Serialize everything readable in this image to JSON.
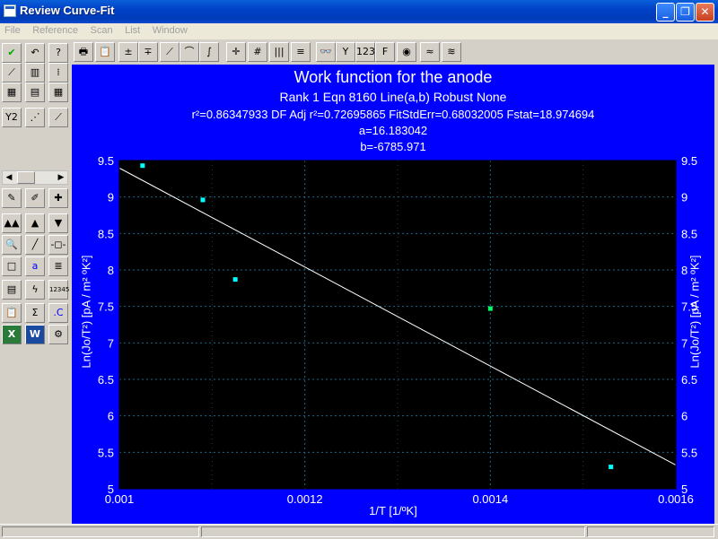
{
  "window": {
    "title": "Review Curve-Fit",
    "controls": [
      "_",
      "❐",
      "✕"
    ]
  },
  "menu": [
    "File",
    "Reference",
    "Scan",
    "List",
    "Window"
  ],
  "toolbar": [
    {
      "name": "print-icon",
      "glyph": "🖶"
    },
    {
      "name": "clipboard-icon",
      "glyph": "📋"
    },
    {
      "name": "plus-box-icon",
      "glyph": "±"
    },
    {
      "name": "minus-box-icon",
      "glyph": "∓"
    },
    {
      "name": "curve-linear-icon",
      "glyph": "⟋"
    },
    {
      "name": "curve-smooth-icon",
      "glyph": "⌒"
    },
    {
      "name": "curve-rise-icon",
      "glyph": "∫"
    },
    {
      "name": "crosshair-icon",
      "glyph": "✛"
    },
    {
      "name": "grid-icon",
      "glyph": "#"
    },
    {
      "name": "bars-icon",
      "glyph": "|||"
    },
    {
      "name": "list-icon",
      "glyph": "≡"
    },
    {
      "name": "binoculars-icon",
      "glyph": "👓"
    },
    {
      "name": "tree-icon",
      "glyph": "Y"
    },
    {
      "name": "numeric-icon",
      "glyph": "123"
    },
    {
      "name": "font-icon",
      "glyph": "F"
    },
    {
      "name": "color-wheel-icon",
      "glyph": "◉"
    },
    {
      "name": "multi-curve-icon",
      "glyph": "≈"
    },
    {
      "name": "multi-curve-alt-icon",
      "glyph": "≋"
    }
  ],
  "palette": [
    [
      "check-icon",
      "undo-icon",
      "help-icon"
    ],
    [
      "fit-line-icon",
      "fit-bars-icon",
      "fit-dots-icon"
    ],
    [
      "fit-grid-icon",
      "fit-stack-icon",
      "fit-table-icon"
    ],
    [
      "y2-icon",
      "fit-scatter-icon",
      "fit-trend-icon"
    ],
    [
      "pen-icon",
      "pen-alt-icon",
      "pen-plus-icon"
    ],
    [
      "triangles-icon",
      "triangle-up-icon",
      "triangle-down-icon"
    ],
    [
      "zoom-icon",
      "diagonal-icon",
      "point-icon"
    ],
    [
      "blank-icon",
      "a-letter-icon",
      "hatch-icon"
    ],
    [
      "sheet-icon",
      "lightning-icon",
      "numbers-icon"
    ],
    [
      "paste-icon",
      "sigma-icon",
      "c-letter-icon"
    ],
    [
      "excel-icon",
      "word-icon",
      "gear-icon"
    ]
  ],
  "palette_glyphs": {
    "check-icon": "✔",
    "undo-icon": "↶",
    "help-icon": "?",
    "fit-line-icon": "⟋",
    "fit-bars-icon": "▥",
    "fit-dots-icon": "⁞",
    "fit-grid-icon": "▦",
    "fit-stack-icon": "▤",
    "fit-table-icon": "▦",
    "y2-icon": "Y2",
    "fit-scatter-icon": "⋰",
    "fit-trend-icon": "⟋",
    "pen-icon": "✎",
    "pen-alt-icon": "✐",
    "pen-plus-icon": "✚",
    "triangles-icon": "▲▲",
    "triangle-up-icon": "▲",
    "triangle-down-icon": "▼",
    "zoom-icon": "🔍",
    "diagonal-icon": "╱",
    "point-icon": "-◻-",
    "blank-icon": "□",
    "a-letter-icon": "a",
    "hatch-icon": "≣",
    "sheet-icon": "▤",
    "lightning-icon": "ϟ",
    "numbers-icon": "12345",
    "paste-icon": "📋",
    "sigma-icon": "Σ",
    "c-letter-icon": ".C",
    "excel-icon": "X",
    "word-icon": "W",
    "gear-icon": "⚙"
  },
  "chart_header": {
    "title": "Work function for the anode",
    "rank_line": "Rank 1  Eqn 8160  Line(a,b) Robust None",
    "stats_line": "r²=0.86347933  DF Adj r²=0.72695865  FitStdErr=0.68032005  Fstat=18.974694",
    "param_a": "a=16.183042",
    "param_b": "b=-6785.971"
  },
  "colors": {
    "plot_frame": "#0000ff",
    "plot_bg": "#000000",
    "grid": "#1a6a8a",
    "fit_line": "#ffffff",
    "point": "#00ffff",
    "point_highlight": "#00ff66"
  },
  "chart_data": {
    "type": "scatter",
    "xlabel": "1/T [1/ºK]",
    "ylabel": "Ln(Jo/T²) [pA / m² ºK²]",
    "xlim": [
      0.001,
      0.0016
    ],
    "ylim": [
      5,
      9.5
    ],
    "x_ticks": [
      "0.001",
      "0.0012",
      "0.0014",
      "0.0016"
    ],
    "y_ticks": [
      "9.5",
      "9",
      "8.5",
      "8",
      "7.5",
      "7",
      "6.5",
      "6",
      "5.5",
      "5"
    ],
    "points": [
      {
        "x": 0.001025,
        "y": 9.43
      },
      {
        "x": 0.00109,
        "y": 8.96
      },
      {
        "x": 0.001125,
        "y": 7.87
      },
      {
        "x": 0.0014,
        "y": 7.47,
        "highlight": true
      },
      {
        "x": 0.00153,
        "y": 5.3
      }
    ],
    "fit": {
      "a": 16.183042,
      "b": -6785.971
    }
  }
}
